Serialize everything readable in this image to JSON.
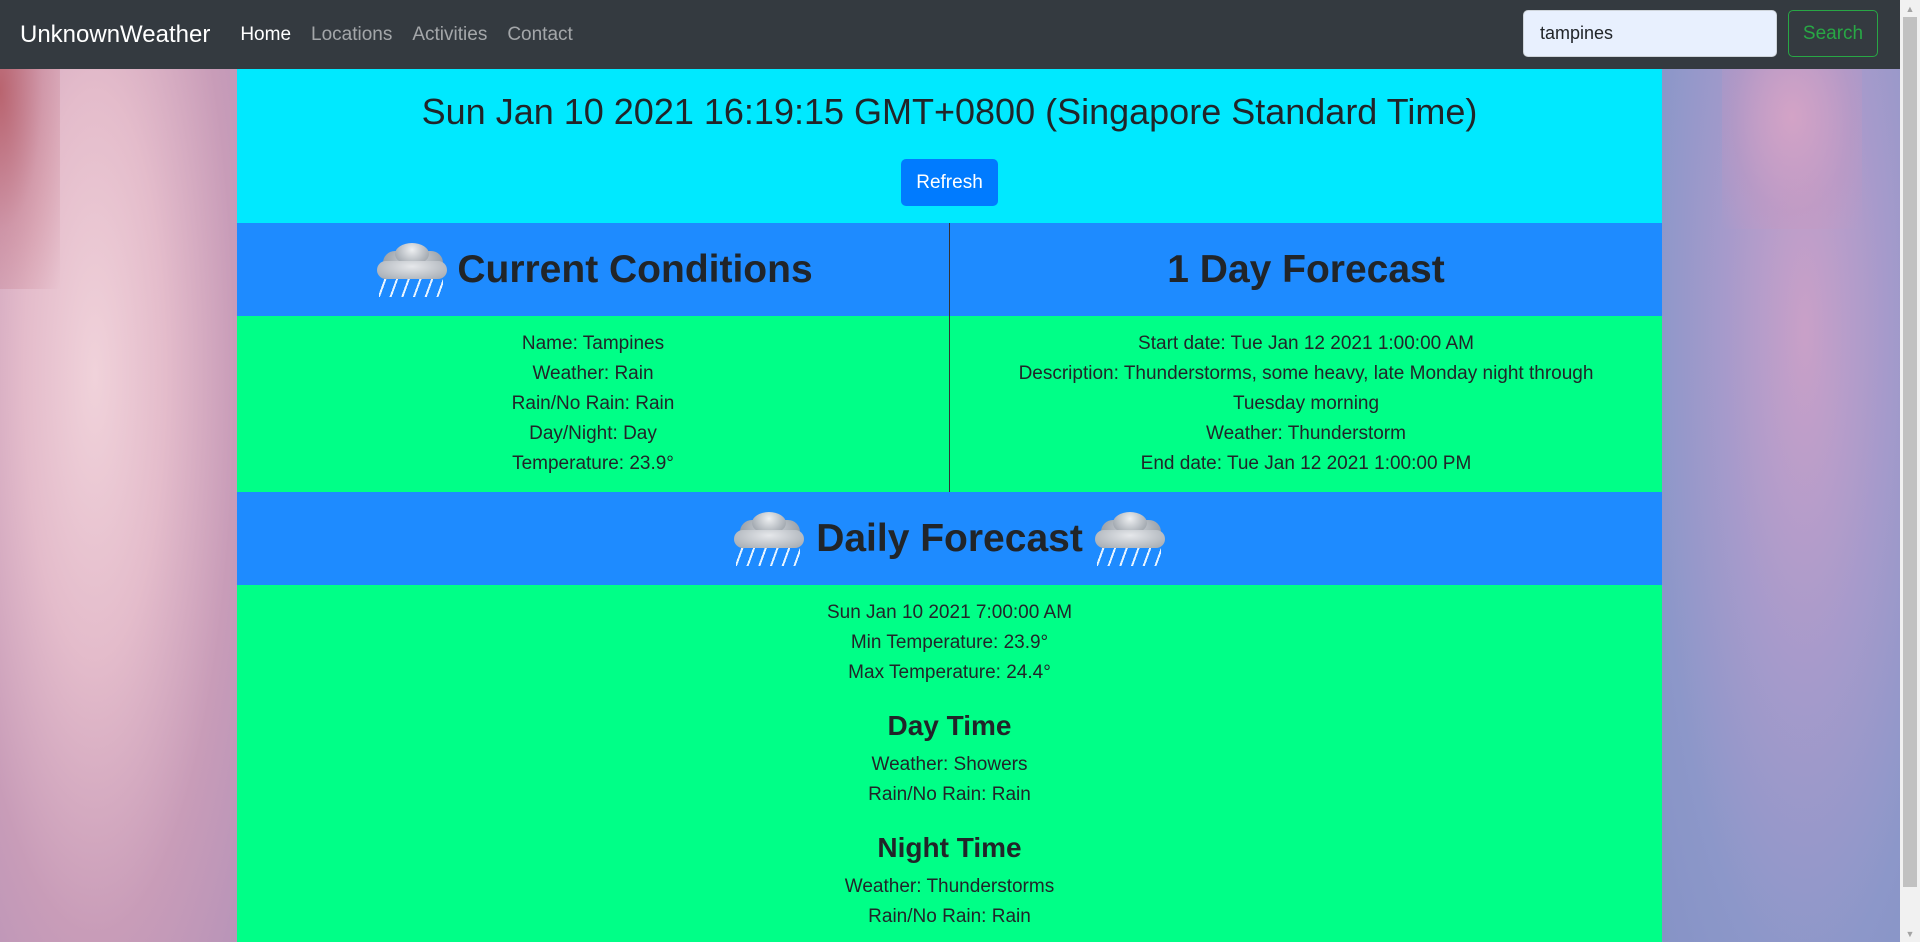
{
  "navbar": {
    "brand": "UnknownWeather",
    "links": [
      "Home",
      "Locations",
      "Activities",
      "Contact"
    ],
    "search_value": "tampines",
    "search_button": "Search"
  },
  "time": {
    "datetime": "Sun Jan 10 2021 16:19:15 GMT+0800 (Singapore Standard Time)",
    "refresh_label": "Refresh"
  },
  "current": {
    "title": "Current Conditions",
    "icon": "rain-cloud-icon",
    "lines": [
      "Name: Tampines",
      "Weather: Rain",
      "Rain/No Rain: Rain",
      "Day/Night: Day",
      "Temperature: 23.9°"
    ]
  },
  "one_day": {
    "title": "1 Day Forecast",
    "lines": [
      "Start date: Tue Jan 12 2021 1:00:00 AM",
      "Description: Thunderstorms, some heavy, late Monday night through Tuesday morning",
      "Weather: Thunderstorm",
      "End date: Tue Jan 12 2021 1:00:00 PM"
    ]
  },
  "daily": {
    "title": "Daily Forecast",
    "lines": [
      "Sun Jan 10 2021 7:00:00 AM",
      "Min Temperature: 23.9°",
      "Max Temperature: 24.4°"
    ],
    "day_title": "Day Time",
    "day_lines": [
      "Weather: Showers",
      "Rain/No Rain: Rain"
    ],
    "night_title": "Night Time",
    "night_lines": [
      "Weather: Thunderstorms",
      "Rain/No Rain: Rain"
    ]
  },
  "colors": {
    "navbar": "#343a40",
    "time_bg": "#00e9ff",
    "head_bg": "#1e8bff",
    "body_bg": "#00ff87",
    "refresh": "#007bff",
    "search": "#28a745"
  }
}
